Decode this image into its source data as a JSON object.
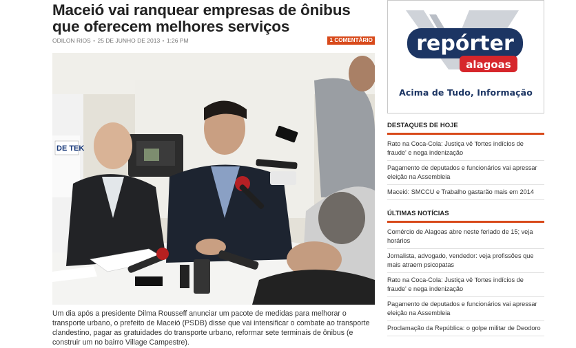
{
  "article": {
    "title": "Maceió vai ranquear empresas de ônibus que oferecem melhores serviços",
    "author": "ODILON RIOS",
    "date": "25 DE JUNHO DE 2013",
    "time": "1:26 PM",
    "separator": "•",
    "comments_label": "1 COMENTÁRIO",
    "body": "Um dia após a presidente Dilma Rousseff anunciar um pacote de medidas para melhorar o transporte urbano, o prefeito de Maceió (PSDB) disse que vai intensificar o combate ao transporte clandestino, pagar as gratuidades do transporte urbano, reformar sete terminais de ônibus (e construir um no bairro Village Campestre).",
    "photo_sign_text": "DE TEK"
  },
  "sidebar": {
    "ad": {
      "logo_word1": "repórter",
      "logo_word2": "alagoas",
      "tagline": "Acima de Tudo, Informação",
      "colors": {
        "navy": "#1c3563",
        "red": "#d6262b",
        "grey": "#c8cdd4"
      }
    },
    "highlights": {
      "title": "DESTAQUES DE HOJE",
      "items": [
        "Rato na Coca-Cola: Justiça vê 'fortes indícios de fraude' e nega indenização",
        "Pagamento de deputados e funcionários vai apressar eleição na Assembleia",
        "Maceió: SMCCU e Trabalho gastarão mais em 2014"
      ]
    },
    "latest": {
      "title": "ÚLTIMAS NOTÍCIAS",
      "items": [
        "Comércio de Alagoas abre neste feriado de 15; veja horários",
        "Jornalista, advogado, vendedor: veja profissões que mais atraem psicopatas",
        "Rato na Coca-Cola: Justiça vê 'fortes indícios de fraude' e nega indenização",
        "Pagamento de deputados e funcionários vai apressar eleição na Assembleia",
        "Proclamação da República: o golpe militar de Deodoro"
      ]
    }
  },
  "colors": {
    "accent": "#d84a1b"
  }
}
